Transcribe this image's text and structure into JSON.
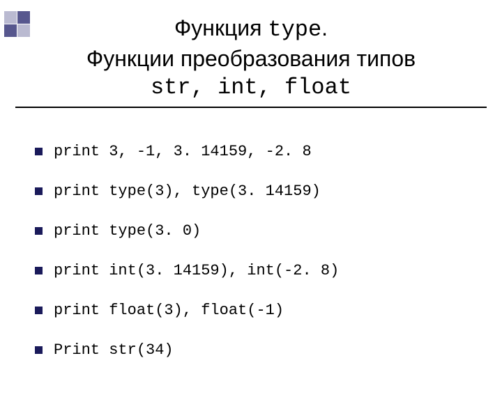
{
  "title": {
    "line1_sans": "Функция ",
    "line1_mono": "type",
    "line1_suffix": ".",
    "line2": "Функции преобразования типов",
    "line3_mono": "str, int, float"
  },
  "items": [
    {
      "text": "print 3, -1, 3. 14159, -2. 8"
    },
    {
      "text": "print type(3), type(3. 14159)"
    },
    {
      "text": "print type(3. 0)"
    },
    {
      "text": "print int(3. 14159), int(-2. 8)"
    },
    {
      "text": "print float(3), float(-1)"
    },
    {
      "text": "Print str(34)"
    }
  ]
}
